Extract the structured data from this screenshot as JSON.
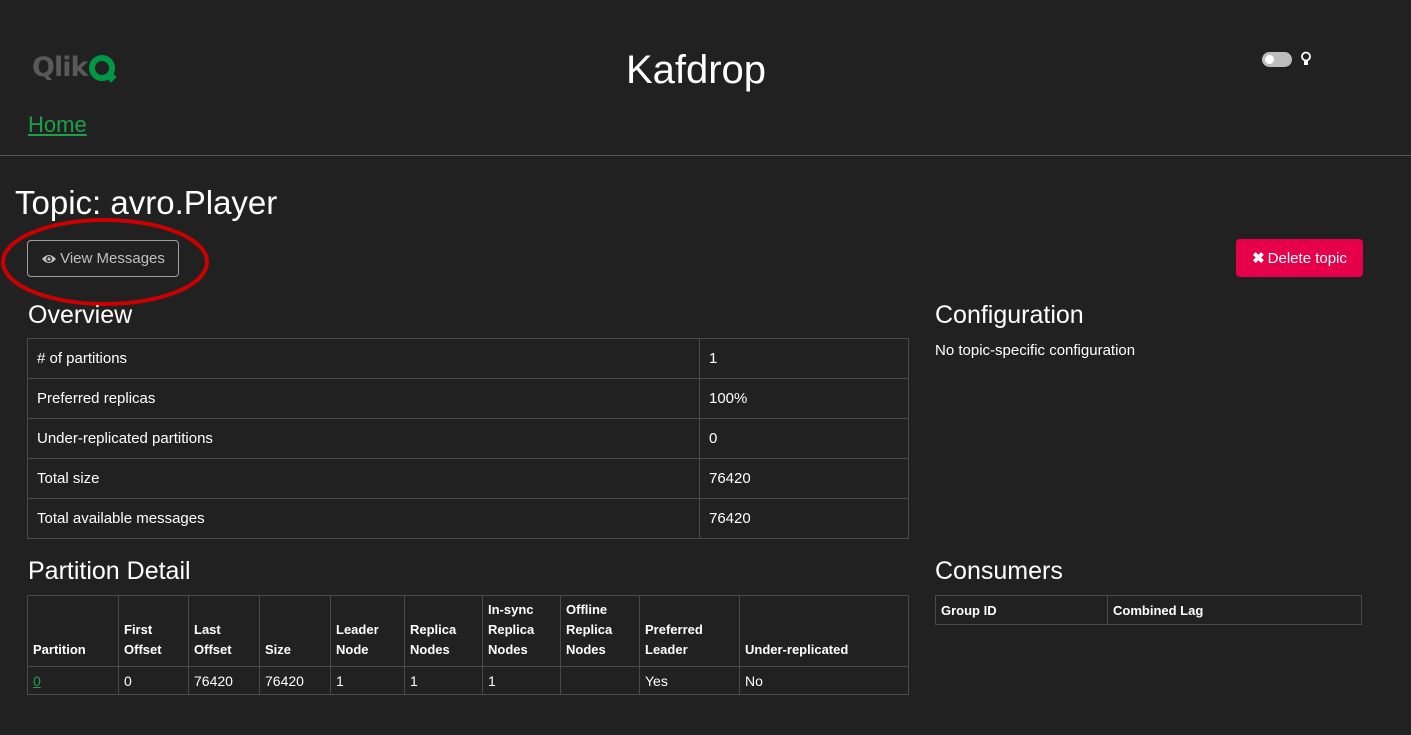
{
  "header": {
    "logo_text": "Qlik",
    "app_title": "Kafdrop",
    "home_link": "Home"
  },
  "topic": {
    "title": "Topic: avro.Player",
    "view_messages_label": "View Messages",
    "delete_label": "Delete topic"
  },
  "overview": {
    "heading": "Overview",
    "rows": [
      {
        "label": "# of partitions",
        "value": "1"
      },
      {
        "label": "Preferred replicas",
        "value": "100%"
      },
      {
        "label": "Under-replicated partitions",
        "value": "0"
      },
      {
        "label": "Total size",
        "value": "76420"
      },
      {
        "label": "Total available messages",
        "value": "76420"
      }
    ]
  },
  "configuration": {
    "heading": "Configuration",
    "text": "No topic-specific configuration"
  },
  "partition_detail": {
    "heading": "Partition Detail",
    "columns": [
      "Partition",
      "First Offset",
      "Last Offset",
      "Size",
      "Leader Node",
      "Replica Nodes",
      "In-sync Replica Nodes",
      "Offline Replica Nodes",
      "Preferred Leader",
      "Under-replicated"
    ],
    "rows": [
      [
        "0",
        "0",
        "76420",
        "76420",
        "1",
        "1",
        "1",
        "",
        "Yes",
        "No"
      ]
    ]
  },
  "consumers": {
    "heading": "Consumers",
    "columns": [
      "Group ID",
      "Combined Lag"
    ]
  },
  "colors": {
    "background": "#212121",
    "link_green": "#1ca04a",
    "delete_red": "#e6004c",
    "logo_green": "#009845",
    "annotation_red": "#cc0000"
  },
  "icons": [
    "eye-icon",
    "close-icon",
    "lightbulb-icon"
  ]
}
